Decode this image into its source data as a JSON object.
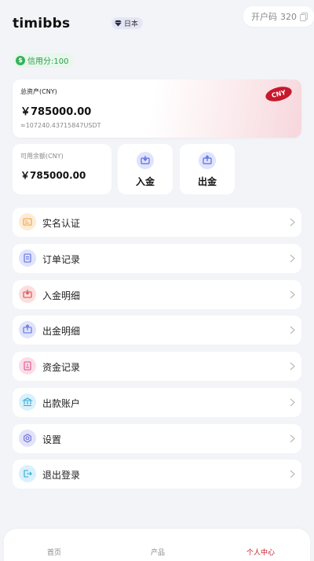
{
  "user": {
    "username": "timibbs",
    "region": "日本",
    "account_code_label": "开户码",
    "account_code": "320",
    "credit_label": "信用分:100"
  },
  "assets": {
    "total_label": "总资产(CNY)",
    "total_amount": "￥785000.00",
    "usdt_equiv": "≈107240.43715847USDT",
    "currency_badge": "CNY",
    "available_label": "可用余额(CNY)",
    "available_amount": "￥785000.00"
  },
  "actions": {
    "deposit": "入金",
    "withdraw": "出金"
  },
  "menu": [
    {
      "label": "实名认证",
      "icon": "id-card-icon",
      "color": "#f0a040",
      "bg": "#fdebd6"
    },
    {
      "label": "订单记录",
      "icon": "clipboard-icon",
      "color": "#5b6cdf",
      "bg": "#dfe3fb"
    },
    {
      "label": "入金明细",
      "icon": "deposit-icon",
      "color": "#e04a4a",
      "bg": "#fbdede"
    },
    {
      "label": "出金明细",
      "icon": "withdraw-icon",
      "color": "#5b6cdf",
      "bg": "#dfe3fb"
    },
    {
      "label": "资金记录",
      "icon": "funds-record-icon",
      "color": "#e0508a",
      "bg": "#fbdde8"
    },
    {
      "label": "出款账户",
      "icon": "bank-account-icon",
      "color": "#2fa8d8",
      "bg": "#d8f1fb"
    },
    {
      "label": "设置",
      "icon": "settings-icon",
      "color": "#6a6fd6",
      "bg": "#e2e3fa"
    },
    {
      "label": "退出登录",
      "icon": "logout-icon",
      "color": "#2fa8d8",
      "bg": "#d8f1fb"
    }
  ],
  "tabbar": {
    "home": "首页",
    "products": "产品",
    "profile": "个人中心"
  },
  "colors": {
    "accent": "#c8182c",
    "credit_green": "#2d9c4b"
  }
}
